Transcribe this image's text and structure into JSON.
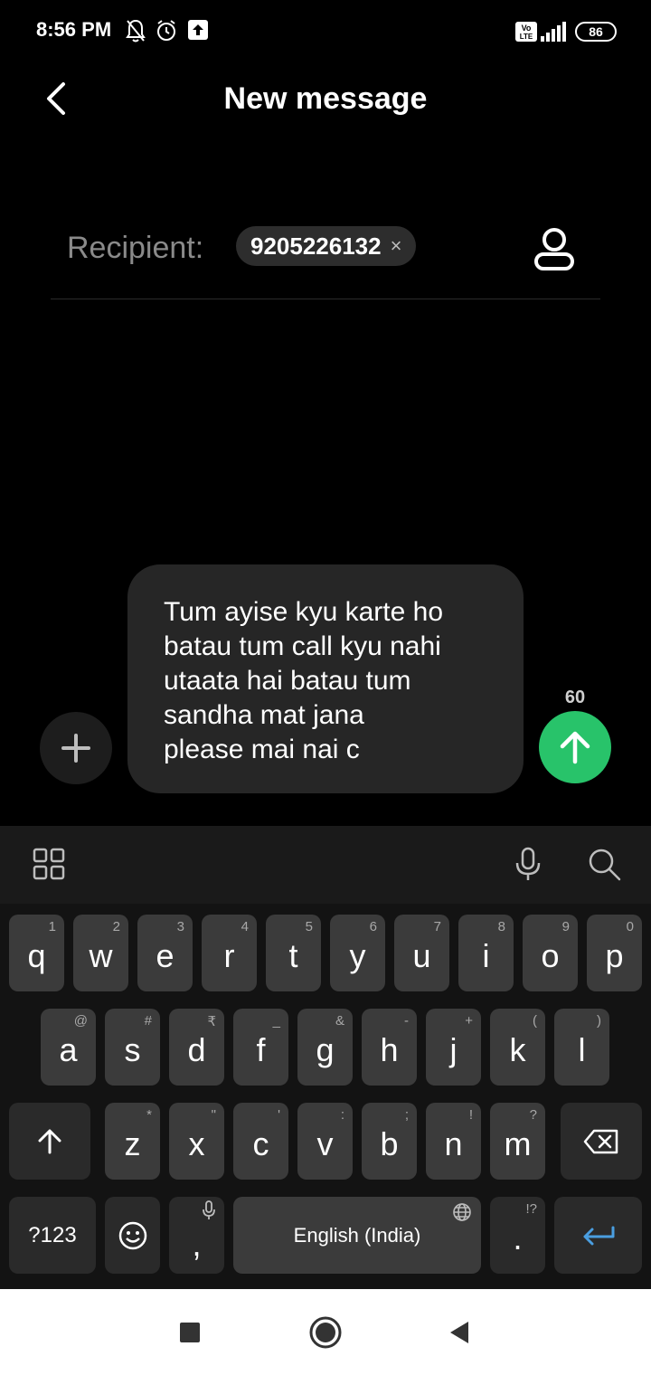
{
  "status_bar": {
    "time": "8:56 PM",
    "battery": "86",
    "network_badge": "Vo LTE",
    "icons": [
      "bell-off-icon",
      "alarm-icon",
      "upload-icon",
      "volte-icon",
      "signal-icon",
      "battery-icon"
    ]
  },
  "header": {
    "title": "New message",
    "back_icon": "chevron-left-icon"
  },
  "recipient": {
    "label": "Recipient:",
    "chip_text": "9205226132",
    "chip_close": "×",
    "contact_icon": "person-icon"
  },
  "compose": {
    "message": "Tum ayise kyu karte ho\nbatau tum call kyu nahi\nutaata hai batau tum\nsandha mat jana\nplease mai nai c",
    "char_count": "60",
    "attach_icon": "plus-icon",
    "send_icon": "arrow-up-icon",
    "send_color": "#28c36a"
  },
  "keyboard": {
    "toolbar_icons": [
      "apps-grid-icon",
      "mic-icon",
      "search-icon"
    ],
    "row1": [
      {
        "label": "q",
        "hint": "1"
      },
      {
        "label": "w",
        "hint": "2"
      },
      {
        "label": "e",
        "hint": "3"
      },
      {
        "label": "r",
        "hint": "4"
      },
      {
        "label": "t",
        "hint": "5"
      },
      {
        "label": "y",
        "hint": "6"
      },
      {
        "label": "u",
        "hint": "7"
      },
      {
        "label": "i",
        "hint": "8"
      },
      {
        "label": "o",
        "hint": "9"
      },
      {
        "label": "p",
        "hint": "0"
      }
    ],
    "row2": [
      {
        "label": "a",
        "hint": "@"
      },
      {
        "label": "s",
        "hint": "#"
      },
      {
        "label": "d",
        "hint": "₹"
      },
      {
        "label": "f",
        "hint": "_"
      },
      {
        "label": "g",
        "hint": "&"
      },
      {
        "label": "h",
        "hint": "-"
      },
      {
        "label": "j",
        "hint": "+"
      },
      {
        "label": "k",
        "hint": "("
      },
      {
        "label": "l",
        "hint": ")"
      }
    ],
    "row3": [
      {
        "label": "z",
        "hint": "*"
      },
      {
        "label": "x",
        "hint": "\""
      },
      {
        "label": "c",
        "hint": "'"
      },
      {
        "label": "v",
        "hint": ":"
      },
      {
        "label": "b",
        "hint": ";"
      },
      {
        "label": "n",
        "hint": "!"
      },
      {
        "label": "m",
        "hint": "?"
      }
    ],
    "symbols_label": "?123",
    "comma_label": ",",
    "space_label": "English (India)",
    "period_label": ".",
    "period_hint": "!?",
    "enter_color": "#4a9ee0"
  },
  "nav_bar": {
    "icons": [
      "recents-square-icon",
      "home-circle-icon",
      "back-triangle-icon"
    ]
  }
}
